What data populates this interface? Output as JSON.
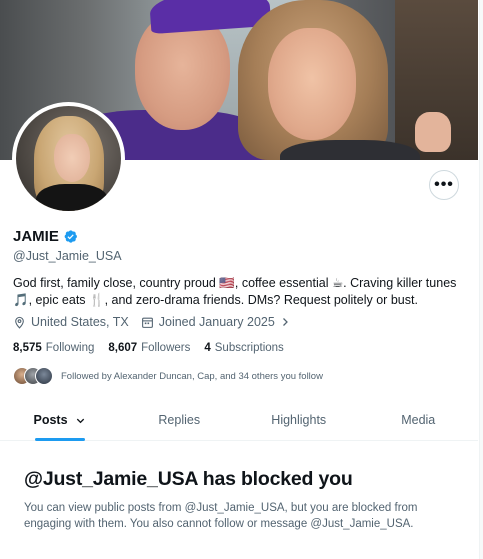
{
  "profile": {
    "display_name": "JAMIE",
    "handle": "@Just_Jamie_USA",
    "bio": "God first, family close, country proud 🇺🇸, coffee essential ☕. Craving killer tunes 🎵, epic eats 🍴, and zero-drama friends. DMs? Request politely or bust.",
    "location": "United States, TX",
    "joined": "Joined January 2025",
    "more_label": "•••"
  },
  "stats": {
    "following_count": "8,575",
    "following_label": "Following",
    "followers_count": "8,607",
    "followers_label": "Followers",
    "subscriptions_count": "4",
    "subscriptions_label": "Subscriptions"
  },
  "followed_by": "Followed by Alexander Duncan, Cap, and 34 others you follow",
  "tabs": [
    {
      "label": "Posts",
      "active": true
    },
    {
      "label": "Replies",
      "active": false
    },
    {
      "label": "Highlights",
      "active": false
    },
    {
      "label": "Media",
      "active": false
    }
  ],
  "blocked": {
    "title": "@Just_Jamie_USA has blocked you",
    "message": "You can view public posts from @Just_Jamie_USA, but you are blocked from engaging with them. You also cannot follow or message @Just_Jamie_USA."
  },
  "colors": {
    "accent": "#1d9bf0",
    "text_primary": "#0f1419",
    "text_secondary": "#536471"
  },
  "icons": [
    "verified-badge-icon",
    "location-icon",
    "calendar-icon",
    "chevron-right-icon",
    "chevron-down-icon",
    "more-icon"
  ]
}
